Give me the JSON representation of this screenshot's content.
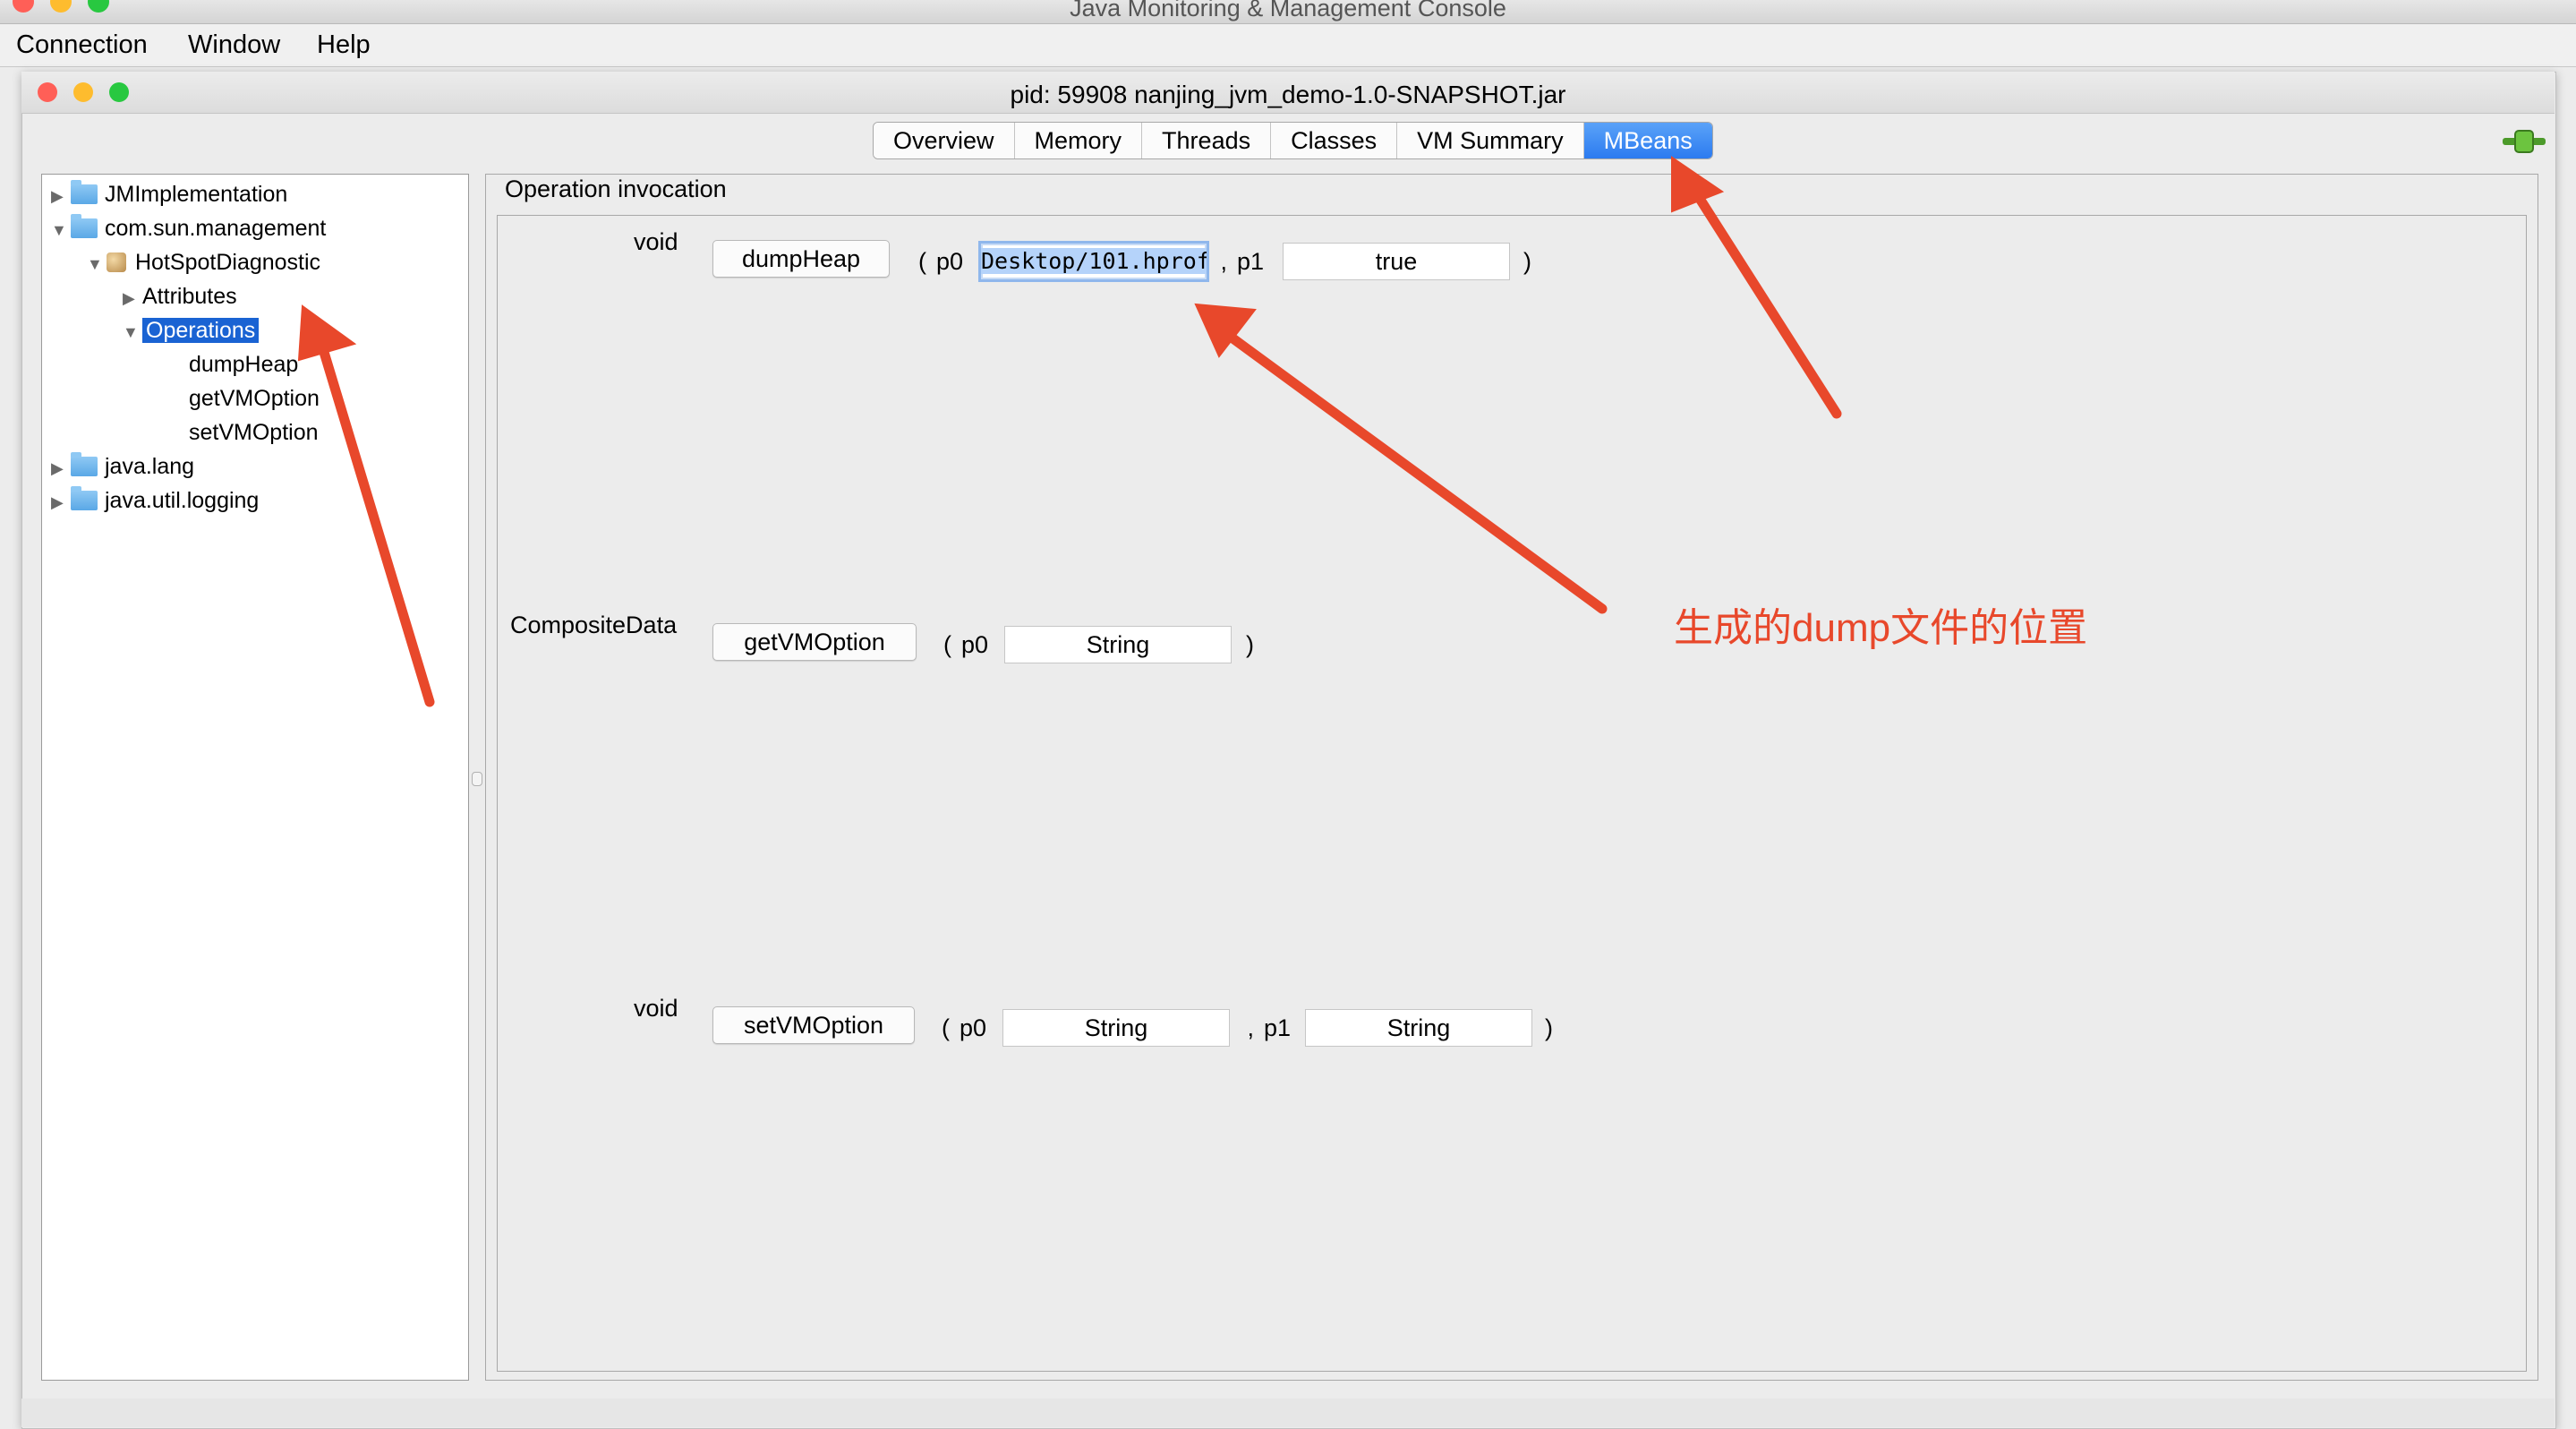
{
  "outer_window": {
    "title": "Java Monitoring & Management Console"
  },
  "menu": {
    "items": [
      "Connection",
      "Window",
      "Help"
    ]
  },
  "inner_window": {
    "title": "pid: 59908 nanjing_jvm_demo-1.0-SNAPSHOT.jar"
  },
  "tabs": [
    {
      "label": "Overview"
    },
    {
      "label": "Memory"
    },
    {
      "label": "Threads"
    },
    {
      "label": "Classes"
    },
    {
      "label": "VM Summary"
    },
    {
      "label": "MBeans",
      "selected": true
    }
  ],
  "tree": {
    "nodes": [
      {
        "label": "JMImplementation",
        "expanded": false,
        "icon": "folder-icon"
      },
      {
        "label": "com.sun.management",
        "expanded": true,
        "icon": "folder-icon"
      },
      {
        "label": "HotSpotDiagnostic",
        "expanded": true,
        "icon": "mbean-icon"
      },
      {
        "label": "Attributes",
        "expanded": false
      },
      {
        "label": "Operations",
        "expanded": true,
        "selected": true
      },
      {
        "label": "dumpHeap"
      },
      {
        "label": "getVMOption"
      },
      {
        "label": "setVMOption"
      },
      {
        "label": "java.lang",
        "expanded": false,
        "icon": "folder-icon"
      },
      {
        "label": "java.util.logging",
        "expanded": false,
        "icon": "folder-icon"
      }
    ]
  },
  "operations_panel": {
    "title": "Operation invocation",
    "operations": [
      {
        "return_type": "void",
        "name": "dumpHeap",
        "params": [
          {
            "label": "p0",
            "value": "Desktop/101.hprof",
            "visible_value": "Desktop/101.hprof"
          },
          {
            "label": "p1",
            "value": "true"
          }
        ]
      },
      {
        "return_type": "CompositeData",
        "name": "getVMOption",
        "params": [
          {
            "label": "p0",
            "value": "String"
          }
        ]
      },
      {
        "return_type": "void",
        "name": "setVMOption",
        "params": [
          {
            "label": "p0",
            "value": "String"
          },
          {
            "label": "p1",
            "value": "String"
          }
        ]
      }
    ],
    "punctuation": {
      "open": "( ",
      "sep": " , ",
      "close": ")"
    }
  },
  "annotation": {
    "text": "生成的dump文件的位置",
    "color": "#e8482b"
  },
  "colors": {
    "selection": "#1a63d3",
    "tab_active": "#2c7bf0",
    "arrow": "#e8482b"
  }
}
